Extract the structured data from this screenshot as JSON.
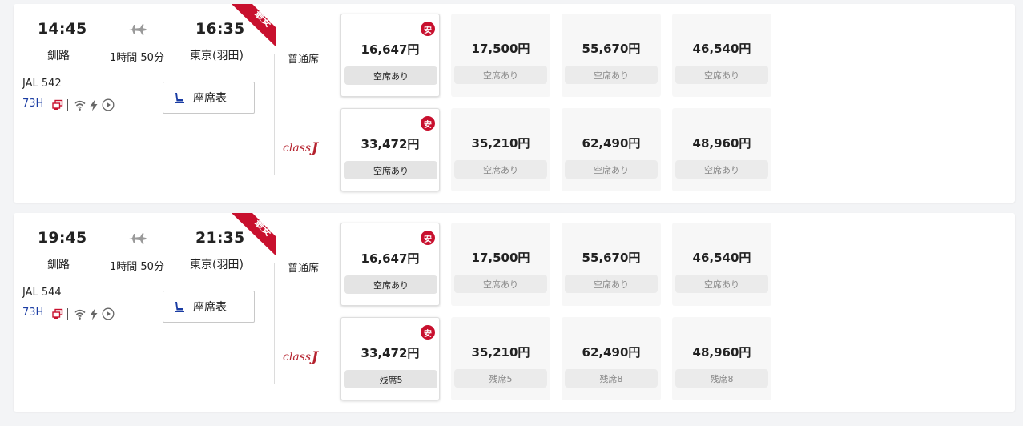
{
  "flights": [
    {
      "departure_time": "14:45",
      "departure_airport": "釧路",
      "arrival_time": "16:35",
      "arrival_airport": "東京(羽田)",
      "duration": "1時間 50分",
      "flight_number": "JAL  542",
      "aircraft": "73H",
      "cheapest_ribbon": "最安",
      "seatmap_button": "座席表",
      "normal_class_label": "普通席",
      "j_class_label": "class",
      "j_class_letter": "J",
      "normal_fares": [
        {
          "price": "16,647円",
          "availability": "空席あり",
          "badge": "安"
        },
        {
          "price": "17,500円",
          "availability": "空席あり"
        },
        {
          "price": "55,670円",
          "availability": "空席あり"
        },
        {
          "price": "46,540円",
          "availability": "空席あり"
        }
      ],
      "j_fares": [
        {
          "price": "33,472円",
          "availability": "空席あり",
          "badge": "安"
        },
        {
          "price": "35,210円",
          "availability": "空席あり"
        },
        {
          "price": "62,490円",
          "availability": "空席あり"
        },
        {
          "price": "48,960円",
          "availability": "空席あり"
        }
      ]
    },
    {
      "departure_time": "19:45",
      "departure_airport": "釧路",
      "arrival_time": "21:35",
      "arrival_airport": "東京(羽田)",
      "duration": "1時間 50分",
      "flight_number": "JAL  544",
      "aircraft": "73H",
      "cheapest_ribbon": "最安",
      "seatmap_button": "座席表",
      "normal_class_label": "普通席",
      "j_class_label": "class",
      "j_class_letter": "J",
      "normal_fares": [
        {
          "price": "16,647円",
          "availability": "空席あり",
          "badge": "安"
        },
        {
          "price": "17,500円",
          "availability": "空席あり"
        },
        {
          "price": "55,670円",
          "availability": "空席あり"
        },
        {
          "price": "46,540円",
          "availability": "空席あり"
        }
      ],
      "j_fares": [
        {
          "price": "33,472円",
          "availability": "残席5",
          "badge": "安"
        },
        {
          "price": "35,210円",
          "availability": "残席5"
        },
        {
          "price": "62,490円",
          "availability": "残席8"
        },
        {
          "price": "48,960円",
          "availability": "残席8"
        }
      ]
    }
  ],
  "colors": {
    "brand_red": "#c8102e",
    "aircraft_blue": "#1a3ca3",
    "class_j_red": "#b5222e"
  },
  "icons": [
    "airplane-icon",
    "seat-icon",
    "seatback-monitor-icon",
    "wifi-icon",
    "power-icon",
    "play-icon"
  ]
}
